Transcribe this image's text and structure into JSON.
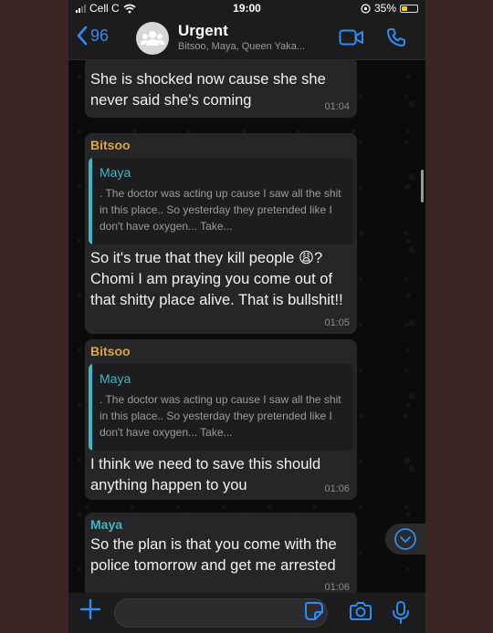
{
  "status_bar": {
    "carrier": "Cell C",
    "time": "19:00",
    "battery_percent": "35%",
    "battery_level": 0.35
  },
  "header": {
    "back_count": "96",
    "title": "Urgent",
    "subtitle": "Bitsoo, Maya, Queen Yaka..."
  },
  "messages": [
    {
      "text": "She is shocked now cause she she never said she's coming",
      "time": "01:04"
    },
    {
      "sender": "Bitsoo",
      "quote": {
        "author": "Maya",
        "text": ". The doctor was acting up cause I saw all the shit in this place.. So yesterday they pretended like I don't have oxygen... Take..."
      },
      "text": "So it's true that they kill people 😩? Chomi I am praying you come out of that shitty place alive. That is bullshit!!",
      "time": "01:05"
    },
    {
      "sender": "Bitsoo",
      "quote": {
        "author": "Maya",
        "text": ". The doctor was acting up cause I saw all the shit in this place.. So yesterday they pretended like I don't have oxygen... Take..."
      },
      "text": "I think we need to save this should anything happen to you",
      "time": "01:06"
    },
    {
      "sender": "Maya",
      "text": "So the plan is that you come with the police tomorrow and get me arrested",
      "time": "01:06"
    }
  ],
  "colors": {
    "accent": "#2f8cf0",
    "sender_bitsoo": "#e0a541",
    "sender_maya": "#3fb7c6",
    "bubble": "#262628"
  }
}
